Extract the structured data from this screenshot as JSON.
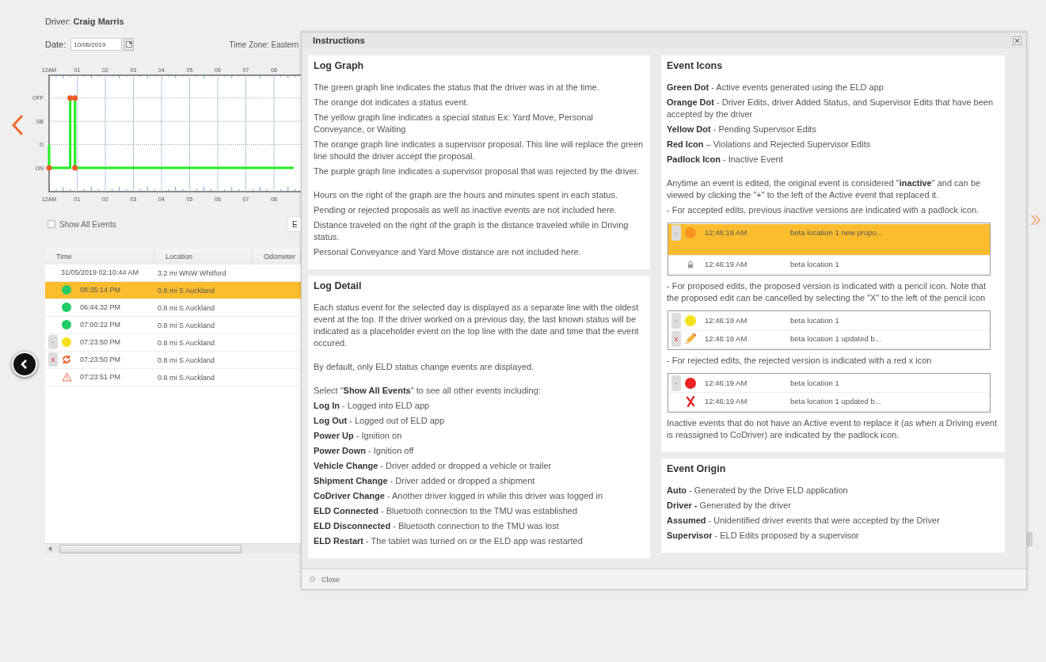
{
  "driver": {
    "label": "Driver: **Craig Marris**"
  },
  "date": {
    "label": "Date:",
    "value": "10/06/2019"
  },
  "time_zone": "Time Zone: Eastern",
  "log_graph": {
    "top_axis_labels": [
      "12AM",
      "01",
      "02",
      "03",
      "04",
      "05",
      "06",
      "07",
      "08"
    ],
    "bottom_axis_labels": [
      "12AM",
      "01",
      "02",
      "03",
      "04",
      "05",
      "06",
      "07",
      "08"
    ],
    "status_labels": [
      "OFF",
      "SB",
      "D",
      "ON"
    ]
  },
  "show_all_events": {
    "label": "Show All Events",
    "checked": false
  },
  "partial_button": "E",
  "events_table": {
    "columns": [
      "Time",
      "Location",
      "Odometer"
    ],
    "rows": [
      {
        "time": "31/05/2019 02:10:44 AM",
        "location": "3.2 mi WNW Whitford",
        "selected": false
      },
      {
        "icon": {
          "kind": "dot",
          "color": "#22cc66"
        },
        "time": "08:35:14 PM",
        "location": "0.8 mi S Auckland",
        "selected": true
      },
      {
        "icon": {
          "kind": "dot",
          "color": "#22cc66"
        },
        "time": "06:44:32 PM",
        "location": "0.8 mi S Auckland",
        "selected": false
      },
      {
        "icon": {
          "kind": "dot",
          "color": "#22cc66"
        },
        "time": "07:00:22 PM",
        "location": "0.8 mi S Auckland",
        "selected": false
      },
      {
        "toggle": {
          "kind": "collapse",
          "label": "-"
        },
        "icon": {
          "kind": "dot",
          "color": "#f5e11a"
        },
        "time": "07:23:50 PM",
        "location": "0.8 mi S Auckland",
        "selected": false
      },
      {
        "toggle": {
          "kind": "cancel",
          "label": "x"
        },
        "icon": {
          "kind": "refresh"
        },
        "time": "07:23:50 PM",
        "location": "0.8 mi S Auckland",
        "selected": false
      },
      {
        "icon": {
          "kind": "warning"
        },
        "time": "07:23:51 PM",
        "location": "0.8 mi S Auckland",
        "selected": false
      }
    ]
  },
  "instructions": {
    "title": "Instructions",
    "footer": "Close",
    "columns": [
      [
        {
          "heading": "Log Graph",
          "groups": [
            [
              {
                "kind": "text",
                "text": "The green graph line indicates the status that the driver was in at the time."
              },
              {
                "kind": "text",
                "text": "The orange dot indicates a status event."
              },
              {
                "kind": "text",
                "text": "The yellow graph line indicates a special status Ex: Yard Move, Personal Conveyance, or Waiting"
              },
              {
                "kind": "text",
                "text": "The orange graph line indicates a supervisor proposal. This line will replace the green line should the driver accept the proposal."
              },
              {
                "kind": "text",
                "text": "The purple graph line indicates a supervisor proposal that was rejected by the driver."
              }
            ],
            [
              {
                "kind": "text",
                "text": "Hours on the right of the graph are the hours and minutes spent in each status."
              },
              {
                "kind": "text",
                "text": "Pending or rejected proposals as well as inactive events are not included here."
              },
              {
                "kind": "text",
                "text": "Distance traveled on the right of the graph is the distance traveled while in Driving status."
              },
              {
                "kind": "text",
                "text": "Personal Conveyance and Yard Move distance are not included here."
              }
            ]
          ]
        },
        {
          "heading": "Log Detail",
          "groups": [
            [
              {
                "kind": "text",
                "text": "Each status event for the selected day is displayed as a separate line with the oldest event at the top. If the driver worked on a previous day, the last known status will be indicated as a placeholder event on the top line with the date and time that the event occured."
              }
            ],
            [
              {
                "kind": "text",
                "text": "By default, only ELD status change events are displayed."
              }
            ],
            [
              {
                "kind": "text",
                "text": "Select \"**Show All Events**\" to see all other events including:"
              },
              {
                "kind": "text",
                "text": "**Log In** - Logged into ELD app"
              },
              {
                "kind": "text",
                "text": "**Log Out** - Logged out of ELD app"
              },
              {
                "kind": "text",
                "text": "**Power Up** - Ignition on"
              },
              {
                "kind": "text",
                "text": "**Power Down** - Ignition off"
              },
              {
                "kind": "text",
                "text": "**Vehicle Change** - Driver added or dropped a vehicle or trailer"
              },
              {
                "kind": "text",
                "text": "**Shipment Change** - Driver added or dropped a shipment"
              },
              {
                "kind": "text",
                "text": "**CoDriver Change** - Another driver logged in while this driver was logged in"
              },
              {
                "kind": "text",
                "text": "**ELD Connected** - Bluetooth connection to the TMU was established"
              },
              {
                "kind": "text",
                "text": "**ELD Disconnected** - Bluetooth connection to the TMU was lost"
              },
              {
                "kind": "text",
                "text": "**ELD Restart** - The tablet was turned on or the ELD app was restarted"
              }
            ]
          ]
        }
      ],
      [
        {
          "heading": "Event Icons",
          "groups": [
            [
              {
                "kind": "text",
                "text": "**Green Dot** - Active events generated using the ELD app"
              },
              {
                "kind": "text",
                "text": "**Orange Dot** - Driver Edits, driver Added Status, and Supervisor Edits that have been accepted by the driver"
              },
              {
                "kind": "text",
                "text": "**Yellow Dot** - Pending Supervisor Edits"
              },
              {
                "kind": "text",
                "text": "**Red Icon** – Violations and Rejected Supervisor Edits"
              },
              {
                "kind": "text",
                "text": "**Padlock Icon** - Inactive Event"
              }
            ],
            [
              {
                "kind": "text",
                "text": "Anytime an event is edited, the original event is considered \"**inactive**\" and can be viewed by clicking the \"+\" to the left of the Active event that replaced it."
              },
              {
                "kind": "text",
                "text": "- For accepted edits, previous inactive versions are indicated with a padlock icon."
              },
              {
                "kind": "example",
                "rows": [
                  {
                    "toggle": {
                      "kind": "collapse",
                      "label": "-"
                    },
                    "icon": {
                      "kind": "dot",
                      "color": "#f7931e"
                    },
                    "time": "12:46:19 AM",
                    "location": "beta location 1 new propo...",
                    "selected": true
                  },
                  {
                    "icon": {
                      "kind": "padlock"
                    },
                    "time": "12:46:19 AM",
                    "location": "beta location 1",
                    "selected": false
                  }
                ]
              },
              {
                "kind": "text",
                "text": "- For proposed edits, the proposed version is indicated with a pencil icon. Note that the proposed edit can be cancelled by selecting the \"X\" to the left of the pencil icon"
              },
              {
                "kind": "example",
                "rows": [
                  {
                    "toggle": {
                      "kind": "collapse",
                      "label": "-"
                    },
                    "icon": {
                      "kind": "dot",
                      "color": "#f5e11a"
                    },
                    "time": "12:46:19 AM",
                    "location": "beta location 1",
                    "selected": false
                  },
                  {
                    "toggle": {
                      "kind": "cancel",
                      "label": "x"
                    },
                    "icon": {
                      "kind": "pencil"
                    },
                    "time": "12:46:19 AM",
                    "location": "beta location 1 updated b...",
                    "selected": false
                  }
                ]
              },
              {
                "kind": "text",
                "text": "- For rejected edits, the rejected version is indicated with a red x icon"
              },
              {
                "kind": "example",
                "rows": [
                  {
                    "toggle": {
                      "kind": "collapse",
                      "label": "-"
                    },
                    "icon": {
                      "kind": "dot",
                      "color": "#ee2222"
                    },
                    "time": "12:46:19 AM",
                    "location": "beta location 1",
                    "selected": false
                  },
                  {
                    "icon": {
                      "kind": "cross"
                    },
                    "time": "12:46:19 AM",
                    "location": "beta location 1 updated b...",
                    "selected": false
                  }
                ]
              },
              {
                "kind": "text",
                "text": "Inactive events that do not have an Active event to replace it (as when a Driving event is reassigned to CoDriver) are indicated by the padlock icon."
              }
            ]
          ]
        },
        {
          "heading": "Event Origin",
          "groups": [
            [
              {
                "kind": "text",
                "text": "**Auto** - Generated by the Drive ELD application"
              },
              {
                "kind": "text",
                "text": "**Driver -** Generated by the driver"
              },
              {
                "kind": "text",
                "text": "**Assumed** - Unidentified driver events that were accepted by the Driver"
              },
              {
                "kind": "text",
                "text": "**Supervisor** - ELD Edits proposed by a supervisor"
              }
            ]
          ]
        }
      ]
    ]
  }
}
